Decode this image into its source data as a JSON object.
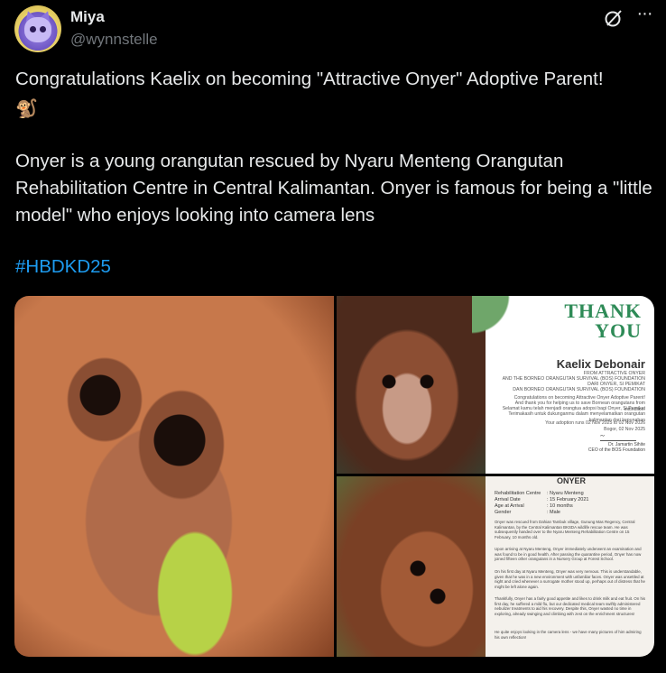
{
  "author": {
    "name": "Miya",
    "handle": "@wynnstelle"
  },
  "header_icons": {
    "grok": "grok-icon",
    "more": "···"
  },
  "post": {
    "line1": "Congratulations Kaelix on becoming \"Attractive Onyer\" Adoptive Parent!",
    "emoji": "🐒",
    "paragraph": "Onyer is a young orangutan rescued by Nyaru Menteng Orangutan Rehabilitation Centre in Central Kalimantan. Onyer is famous for being a \"little model\" who enjoys looking into camera lens",
    "hashtag": "#HBDKD25",
    "hashtag_color": "#1d9bf0"
  },
  "media": {
    "card": {
      "thank_line1": "THANK",
      "thank_line2": "YOU",
      "recipient": "Kaelix Debonair",
      "lines": [
        "FROM ATTRACTIVE ONYER",
        "AND THE BORNEO ORANGUTAN SURVIVAL (BOS) FOUNDATION",
        "DARI ONYER, SI PEMIKAT",
        "DAN BORNEO ORANGUTAN SURVIVAL (BOS) FOUNDATION",
        "Congratulations on becoming Attractive Onyer Adoptive Parent!",
        "And thank you for helping us to save Bornean orangutans from extinction!",
        "Selamat kamu telah menjadi orangtua adopsi bagi Onyer, Si Pemikat",
        "Terimakasih untuk dukunganmu dalam menyelamatkan orangutan kalimantan dari kepunahan",
        "Your adoption runs 02 Nov 2025 to 02 Nov 2026",
        "Bogor, 02 Nov 2025"
      ],
      "signer": "Dr. Jamartin Sihite",
      "signer_title": "CEO of the BOS Foundation"
    },
    "doc": {
      "heading": "ONYER",
      "fields": [
        {
          "k": "Rehabilitation Centre",
          "v": ": Nyaru Menteng"
        },
        {
          "k": "Arrival Date",
          "v": ": 15 February 2021"
        },
        {
          "k": "Age at Arrival",
          "v": ": 10 months"
        },
        {
          "k": "Gender",
          "v": ": Male"
        }
      ],
      "paragraphs": [
        "Onyer was rescued from Dahian Tambuk village, Gunung Mas Regency, Central Kalimantan, by the Central Kalimantan BKSDA wildlife rescue team. He was subsequently handed over to the Nyaru Menteng Rehabilitation Centre on 15 February, 10 months old.",
        "Upon arriving at Nyaru Menteng, Onyer immediately underwent an examination and was found to be in good health. After passing the quarantine period, Onyer has now joined fifteen other orangutans in a Nursery Group at Forest School.",
        "On his first day at Nyaru Menteng, Onyer was very nervous. This is understandable, given that he was in a new environment with unfamiliar faces. Onyer was unsettled at night and cried whenever a surrogate mother stood up, perhaps out of distress that he might be left alone again.",
        "Thankfully, Onyer has a fairly good appetite and likes to drink milk and eat fruit. On his first day, he suffered a mild flu, but our dedicated medical team swiftly administered nebulizer treatments to aid his recovery. Despite this, Onyer wasted no time in exploring, already swinging and climbing with zest on the enrichment structures!",
        "He quite enjoys looking in the camera lens - we have many pictures of him admiring his own reflection!"
      ]
    }
  }
}
